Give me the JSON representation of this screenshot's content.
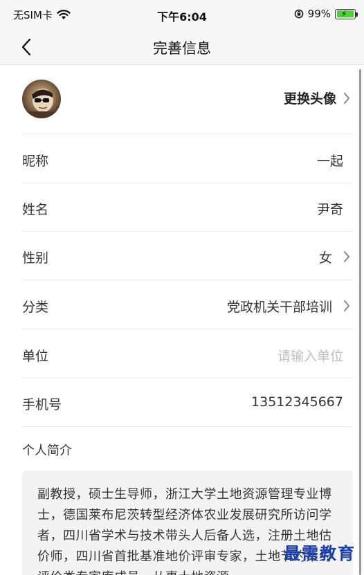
{
  "status_bar": {
    "carrier": "无SIM卡",
    "time": "下午6:04",
    "battery": "99%",
    "battery_level": 0.99
  },
  "nav": {
    "title": "完善信息"
  },
  "avatar_row": {
    "action_label": "更换头像"
  },
  "rows": [
    {
      "label": "昵称",
      "value": "一起"
    },
    {
      "label": "姓名",
      "value": "尹奇"
    },
    {
      "label": "性别",
      "value": "女"
    },
    {
      "label": "分类",
      "value": "党政机关干部培训"
    },
    {
      "label": "单位",
      "placeholder": "请输入单位"
    },
    {
      "label": "手机号",
      "value": "13512345667"
    }
  ],
  "intro": {
    "label": "个人简介",
    "text": "副教授，硕士生导师，浙江大学土地资源管理专业博士，德国莱布尼茨转型经济体农业发展研究所访问学者，四川省学术与技术带头人后备人选，注册土地估价师，四川省首批基准地价评审专家，土地节约集约评价类专家库成员，从事土地资源"
  },
  "watermark": "最需教育"
}
